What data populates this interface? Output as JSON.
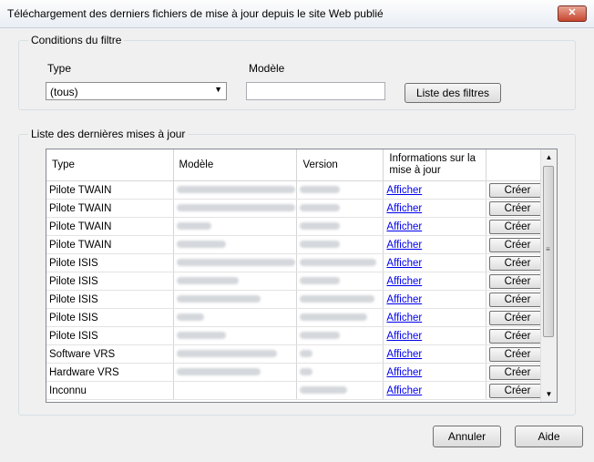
{
  "window": {
    "title": "Téléchargement des derniers fichiers de mise à jour depuis le site Web publié",
    "close_icon": "close-icon"
  },
  "filter": {
    "legend": "Conditions du filtre",
    "type_label": "Type",
    "type_value": "(tous)",
    "model_label": "Modèle",
    "model_value": "",
    "filter_list_button": "Liste des filtres"
  },
  "updates": {
    "legend": "Liste des dernières mises à jour",
    "columns": [
      "Type",
      "Modèle",
      "Version",
      "Informations sur la mise à jour"
    ],
    "link_label": "Afficher",
    "create_label": "Créer",
    "rows": [
      {
        "type": "Pilote TWAIN"
      },
      {
        "type": "Pilote TWAIN"
      },
      {
        "type": "Pilote TWAIN"
      },
      {
        "type": "Pilote TWAIN"
      },
      {
        "type": "Pilote ISIS"
      },
      {
        "type": "Pilote ISIS"
      },
      {
        "type": "Pilote ISIS"
      },
      {
        "type": "Pilote ISIS"
      },
      {
        "type": "Pilote ISIS"
      },
      {
        "type": "Software VRS"
      },
      {
        "type": "Hardware VRS"
      },
      {
        "type": "Inconnu"
      }
    ]
  },
  "buttons": {
    "cancel": "Annuler",
    "help": "Aide"
  }
}
